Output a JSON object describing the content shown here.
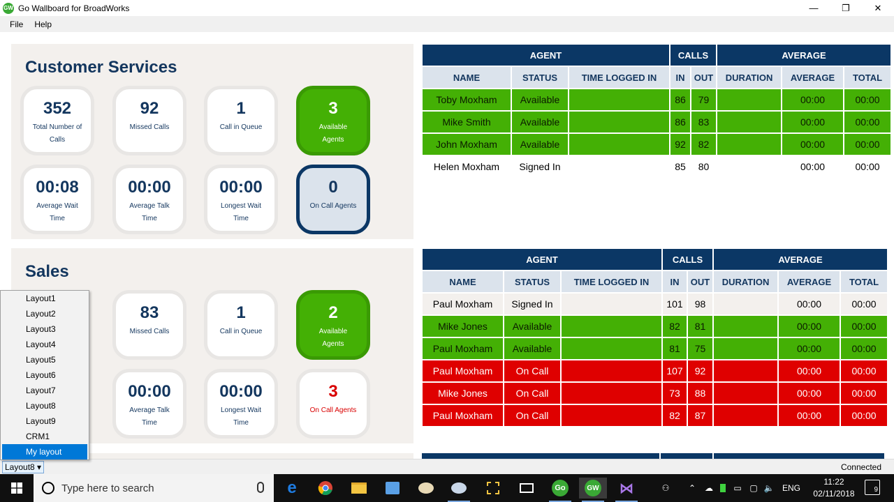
{
  "window": {
    "title": "Go Wallboard for BroadWorks",
    "icon_text": "GW",
    "minimize": "—",
    "restore": "❐",
    "close": "✕"
  },
  "menu": {
    "file": "File",
    "help": "Help"
  },
  "queues": [
    {
      "title": "Customer Services",
      "tiles": [
        {
          "value": "352",
          "label": "Total Number of Calls"
        },
        {
          "value": "92",
          "label": "Missed Calls"
        },
        {
          "value": "1",
          "label": "Call in Queue"
        },
        {
          "value": "3",
          "label": "Available Agents"
        },
        {
          "value": "00:08",
          "label": "Average Wait Time"
        },
        {
          "value": "00:00",
          "label": "Average Talk Time"
        },
        {
          "value": "00:00",
          "label": "Longest Wait Time"
        },
        {
          "value": "0",
          "label": "On Call Agents"
        }
      ]
    },
    {
      "title": "Sales",
      "tiles": [
        {
          "value": "83",
          "label": "Missed Calls"
        },
        {
          "value": "1",
          "label": "Call in Queue"
        },
        {
          "value": "2",
          "label": "Available Agents"
        },
        {
          "value": "00:00",
          "label": "Average Talk Time"
        },
        {
          "value": "00:00",
          "label": "Longest Wait Time"
        },
        {
          "value": "3",
          "label": "On Call Agents"
        }
      ]
    }
  ],
  "table_headers": {
    "agent": "AGENT",
    "calls": "CALLS",
    "average": "AVERAGE",
    "name": "NAME",
    "status": "STATUS",
    "time_logged_in": "TIME LOGGED IN",
    "in": "IN",
    "out": "OUT",
    "duration": "DURATION",
    "avg": "AVERAGE",
    "total": "TOTAL"
  },
  "agents_cs": [
    {
      "name": "Toby Moxham",
      "status": "Available",
      "in": "86",
      "out": "79",
      "average": "00:00",
      "total": "00:00"
    },
    {
      "name": "Mike Smith",
      "status": "Available",
      "in": "86",
      "out": "83",
      "average": "00:00",
      "total": "00:00"
    },
    {
      "name": "John Moxham",
      "status": "Available",
      "in": "92",
      "out": "82",
      "average": "00:00",
      "total": "00:00"
    },
    {
      "name": "Helen Moxham",
      "status": "Signed In",
      "in": "85",
      "out": "80",
      "average": "00:00",
      "total": "00:00"
    }
  ],
  "agents_sales": [
    {
      "name": "Paul Moxham",
      "status": "Signed In",
      "in": "101",
      "out": "98",
      "average": "00:00",
      "total": "00:00"
    },
    {
      "name": "Mike Jones",
      "status": "Available",
      "in": "82",
      "out": "81",
      "average": "00:00",
      "total": "00:00"
    },
    {
      "name": "Paul Moxham",
      "status": "Available",
      "in": "81",
      "out": "75",
      "average": "00:00",
      "total": "00:00"
    },
    {
      "name": "Paul Moxham",
      "status": "On Call",
      "in": "107",
      "out": "92",
      "average": "00:00",
      "total": "00:00"
    },
    {
      "name": "Mike Jones",
      "status": "On Call",
      "in": "73",
      "out": "88",
      "average": "00:00",
      "total": "00:00"
    },
    {
      "name": "Paul Moxham",
      "status": "On Call",
      "in": "82",
      "out": "87",
      "average": "00:00",
      "total": "00:00"
    }
  ],
  "layout_menu": [
    "Layout1",
    "Layout2",
    "Layout3",
    "Layout4",
    "Layout5",
    "Layout6",
    "Layout7",
    "Layout8",
    "Layout9",
    "CRM1",
    "My layout"
  ],
  "status": {
    "layout_selected": "Layout8 ▾",
    "connection": "Connected"
  },
  "taskbar": {
    "search_placeholder": "Type here to search",
    "lang": "ENG",
    "time": "11:22",
    "date": "02/11/2018",
    "notification_count": "9",
    "go_label": "Go",
    "gw_label": "GW"
  },
  "colors": {
    "navy": "#0b3765",
    "header_light": "#dbe3ec",
    "available_green": "#44b005",
    "oncall_red": "#df0000",
    "panel_bg": "#f3f0ed"
  }
}
